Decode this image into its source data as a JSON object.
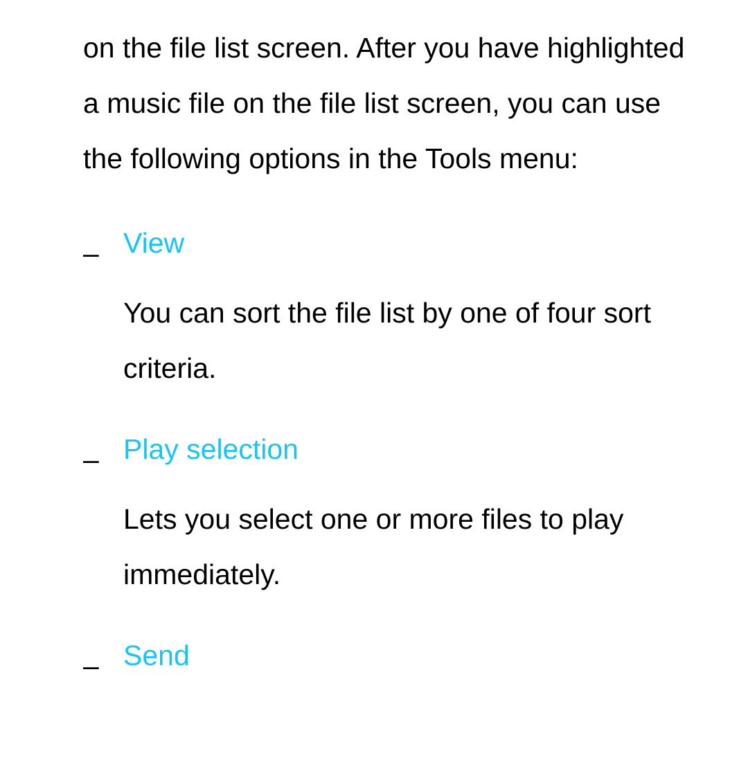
{
  "intro": "on the file list screen. After you have highlighted a music file on the file list screen, you can use the following options in the Tools menu:",
  "items": [
    {
      "dash": "–",
      "title": "View",
      "desc": "You can sort the file list by one of four sort criteria."
    },
    {
      "dash": "–",
      "title": "Play selection",
      "desc": "Lets you select one or more files to play immediately."
    },
    {
      "dash": "–",
      "title": "Send",
      "desc": ""
    }
  ]
}
